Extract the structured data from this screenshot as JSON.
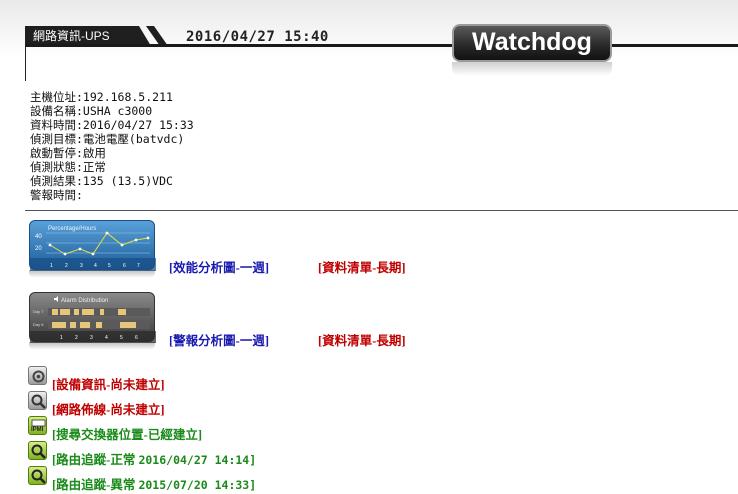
{
  "header": {
    "tab_label": "網路資訊-UPS",
    "datetime": "2016/04/27 15:40",
    "logo": "Watchdog"
  },
  "info": {
    "rows": [
      "主機位址:192.168.5.211",
      "設備名稱:USHA c3000",
      "資料時間:2016/04/27 15:33",
      "偵測目標:電池電壓(batvdc)",
      "啟動暫停:啟用",
      "偵測狀態:正常",
      "偵測結果:135 (13.5)VDC",
      "警報時間:"
    ]
  },
  "perf_chart": {
    "title": "Percentage/Hours",
    "yticks": [
      "40",
      "20"
    ],
    "xticks": [
      "1",
      "2",
      "3",
      "4",
      "5",
      "6",
      "7"
    ],
    "link_chart": "[效能分析圖-一週]",
    "link_list": "[資料清單-長期]"
  },
  "alarm_chart": {
    "title": "Alarm Distribution",
    "rows": [
      "Day 7",
      "Day 6"
    ],
    "xticks": [
      "1",
      "2",
      "3",
      "4",
      "5",
      "6"
    ],
    "link_chart": "[警報分析圖-一週]",
    "link_list": "[資料清單-長期]"
  },
  "status_links": [
    {
      "icon": "gear-icon",
      "label": "[設備資訊-尚未建立]",
      "time": "",
      "color": "red"
    },
    {
      "icon": "magnifier-icon",
      "label": "[網路佈線-尚未建立]",
      "time": "",
      "color": "red"
    },
    {
      "icon": "ipmi-icon",
      "label": "[搜尋交換器位置-已經建立]",
      "time": "",
      "color": "green"
    },
    {
      "icon": "route-trace-icon",
      "label": "[路由追蹤-正常",
      "time": "2016/04/27 14:14]",
      "color": "green"
    },
    {
      "icon": "route-trace-icon",
      "label": "[路由追蹤-異常",
      "time": "2015/07/20 14:33]",
      "color": "green"
    }
  ],
  "colors": {
    "link_blue": "#1a1ab0",
    "link_red": "#c00000",
    "link_green": "#1a8a1a"
  }
}
